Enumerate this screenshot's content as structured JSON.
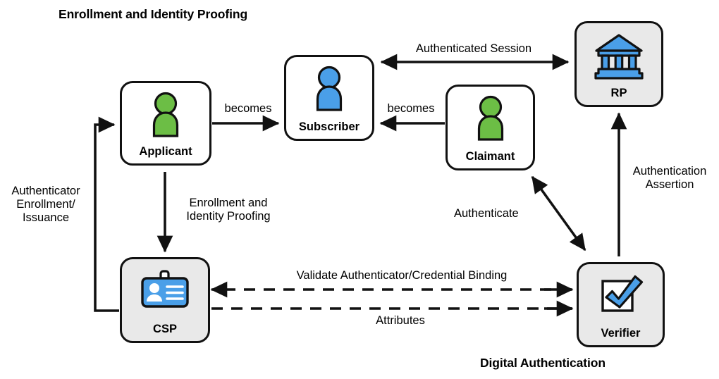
{
  "diagram": {
    "title_enrollment": "Enrollment and Identity Proofing",
    "title_digital": "Digital Authentication",
    "colors": {
      "person_green": "#6cbe45",
      "person_blue": "#4a9fe8",
      "node_grey": "#e9e9e9",
      "stroke": "#111111",
      "background": "#ffffff"
    }
  },
  "nodes": {
    "applicant": {
      "label": "Applicant",
      "icon": "person-icon",
      "fill": "white"
    },
    "subscriber": {
      "label": "Subscriber",
      "icon": "person-icon",
      "fill": "white"
    },
    "claimant": {
      "label": "Claimant",
      "icon": "person-icon",
      "fill": "white"
    },
    "rp": {
      "label": "RP",
      "icon": "bank-icon",
      "fill": "grey"
    },
    "csp": {
      "label": "CSP",
      "icon": "id-card-icon",
      "fill": "grey"
    },
    "verifier": {
      "label": "Verifier",
      "icon": "checkmark-icon",
      "fill": "grey"
    }
  },
  "edges": {
    "applicant_to_subscriber": "becomes",
    "claimant_to_subscriber": "becomes",
    "subscriber_rp_session": "Authenticated Session",
    "verifier_to_rp": "Authentication\nAssertion",
    "csp_to_applicant": "Authenticator\nEnrollment/\nIssuance",
    "applicant_to_csp": "Enrollment and\nIdentity Proofing",
    "claimant_verifier": "Authenticate",
    "validate_binding": "Validate Authenticator/Credential Binding",
    "attributes": "Attributes"
  }
}
